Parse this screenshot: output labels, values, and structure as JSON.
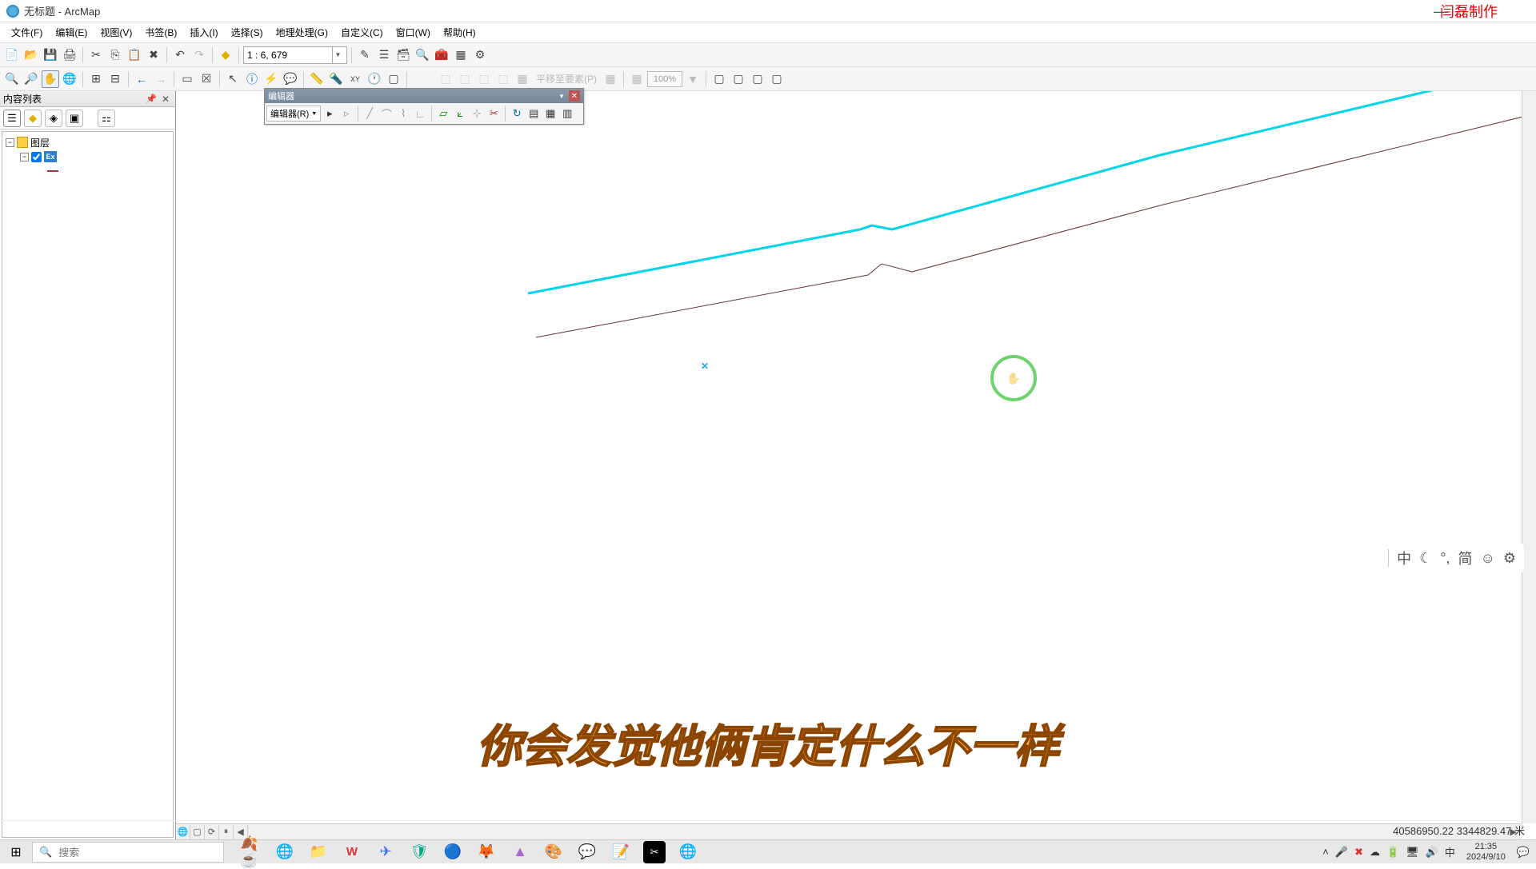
{
  "title": "无标题 - ArcMap",
  "watermark": "闫磊制作",
  "menu": [
    "文件(F)",
    "编辑(E)",
    "视图(V)",
    "书签(B)",
    "插入(I)",
    "选择(S)",
    "地理处理(G)",
    "自定义(C)",
    "窗口(W)",
    "帮助(H)"
  ],
  "scale": "1 : 6, 679",
  "zoom_percent": "100%",
  "disabled_label": "平移至要素(P)",
  "toc": {
    "title": "内容列表",
    "root": "图层",
    "layer_badge": "Ex"
  },
  "editor": {
    "title": "编辑器",
    "dropdown": "编辑器(R)"
  },
  "caption": "你会发觉他俩肯定什么不一样",
  "ime": {
    "items": [
      "中",
      "☾",
      "°,",
      "简",
      "☺",
      "⚙"
    ]
  },
  "status": {
    "coords": "40586950.22 3344829.47 米"
  },
  "taskbar": {
    "search_placeholder": "搜索",
    "time": "21:35",
    "date": "2024/9/10",
    "ime_lang": "中"
  }
}
